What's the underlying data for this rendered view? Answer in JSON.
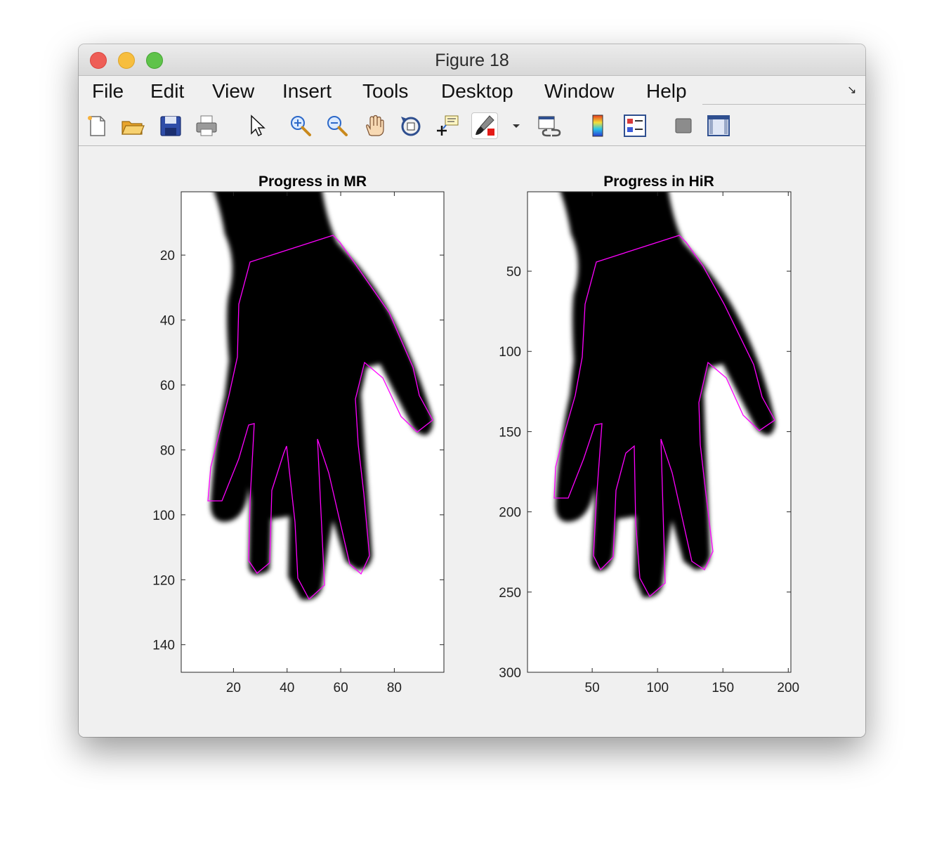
{
  "window": {
    "title": "Figure 18"
  },
  "menu": [
    "File",
    "Edit",
    "View",
    "Insert",
    "Tools",
    "Desktop",
    "Window",
    "Help"
  ],
  "toolbar": [
    "new-figure-icon",
    "open-file-icon",
    "save-icon",
    "print-icon",
    "edit-plot-arrow-icon",
    "zoom-in-icon",
    "zoom-out-icon",
    "pan-hand-icon",
    "rotate-3d-icon",
    "data-cursor-icon",
    "brush-icon",
    "brush-dropdown-icon",
    "link-plot-icon",
    "colorbar-icon",
    "legend-icon",
    "hide-plot-tools-icon",
    "show-plot-tools-icon"
  ],
  "colors": {
    "outline": "#ff00ff",
    "hand": "#000000",
    "axes_bg": "#ffffff"
  },
  "chart_data": [
    {
      "type": "image",
      "title": "Progress in MR",
      "xticks": [
        20,
        40,
        60,
        80
      ],
      "yticks": [
        20,
        40,
        60,
        80,
        100,
        120,
        140
      ],
      "xlim": [
        0.5,
        98.5
      ],
      "ylim": [
        0.5,
        148.5
      ],
      "y_reversed": true,
      "outline_overlay": true
    },
    {
      "type": "image",
      "title": "Progress in HiR",
      "xticks": [
        50,
        100,
        150,
        200
      ],
      "yticks": [
        50,
        100,
        150,
        200,
        250,
        300
      ],
      "xlim": [
        0.5,
        202
      ],
      "ylim": [
        0.5,
        300
      ],
      "y_reversed": true,
      "outline_overlay": true
    }
  ]
}
